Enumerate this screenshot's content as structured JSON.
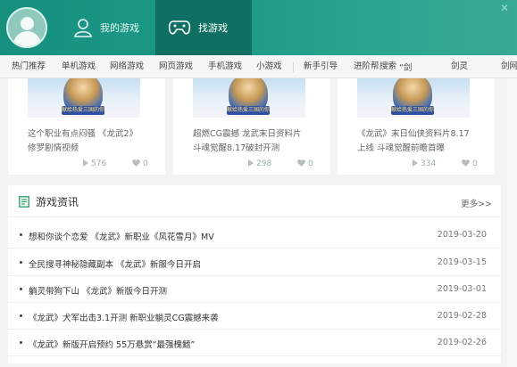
{
  "header": {
    "tabs": [
      {
        "label": "我的游戏",
        "icon": "user-icon"
      },
      {
        "label": "找游戏",
        "icon": "gamepad-icon",
        "active": true
      }
    ],
    "close_glyph": "✕"
  },
  "categories": [
    "热门推荐",
    "单机游戏",
    "网络游戏",
    "网页游戏",
    "手机游戏",
    "小游戏",
    "新手引导",
    "进阶帮",
    "剑灵",
    "剑网"
  ],
  "search": {
    "label": "搜索",
    "value": "“剑"
  },
  "game_cards": [
    {
      "title": "这个职业有点闷骚 《龙武2》修罗剧情视频",
      "plays": "576",
      "likes": "0",
      "image_text": "献给热爱三国的你"
    },
    {
      "title": "超燃CG震撼 龙武末日资料片斗魂觉醒8.17破封开测",
      "plays": "298",
      "likes": "0",
      "image_text": "献给热爱三国的你"
    },
    {
      "title": "《龙武》末日仙侠资料片8.17上线 斗魂觉醒前瞻首曝",
      "plays": "334",
      "likes": "0",
      "image_text": "献给热爱三国的你"
    }
  ],
  "news": {
    "title": "游戏资讯",
    "more_label": "更多>>",
    "items": [
      {
        "text": "想和你谈个恋爱 《龙武》新职业《风花雪月》MV",
        "date": "2019-03-20"
      },
      {
        "text": "全民搜寻神秘隐藏副本 《龙武》新服今日开启",
        "date": "2019-03-15"
      },
      {
        "text": "躺灵带狗下山 《龙武》新版今日开测",
        "date": "2019-03-01"
      },
      {
        "text": "《龙武》犬军出击3.1开测 新职业躺灵CG震撼来袭",
        "date": "2019-02-28"
      },
      {
        "text": "《龙武》新版开启预约 55万悬赏“最强槐鳍”",
        "date": "2019-02-26"
      }
    ]
  },
  "colors": {
    "header_gradient": "#1c9b86",
    "active_tab": "#0f6f63",
    "accent_green": "#2fa36b"
  }
}
